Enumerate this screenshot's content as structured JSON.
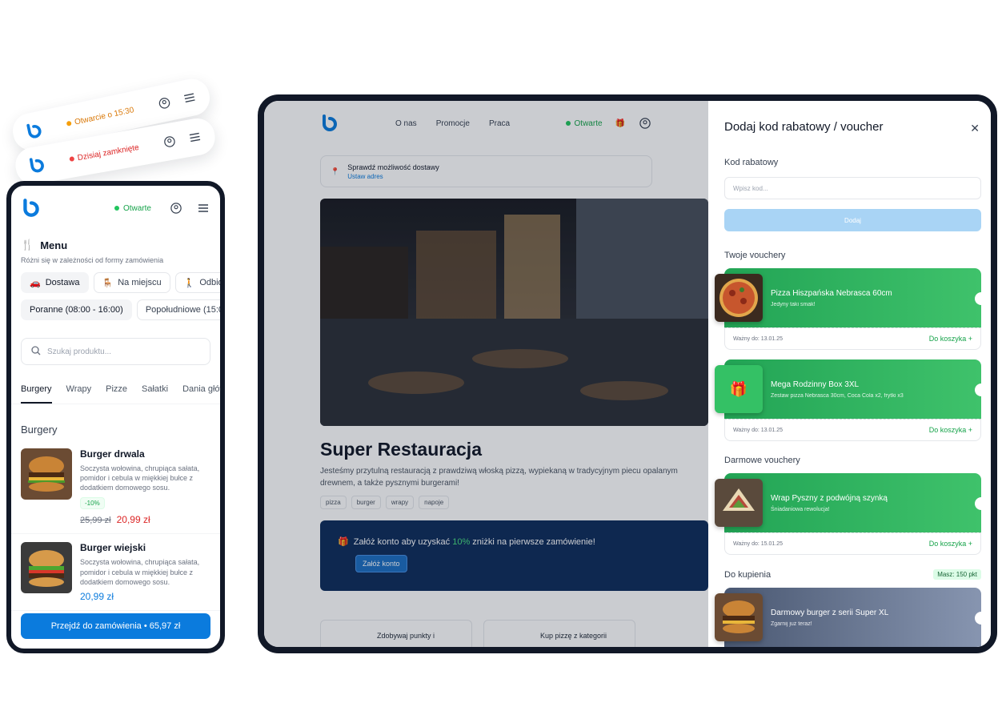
{
  "pills": [
    {
      "status": "Otwarcie o 15:30",
      "color": "#f59e0b"
    },
    {
      "status": "Dzisiaj zamknięte",
      "color": "#ef4444"
    }
  ],
  "phone": {
    "status": "Otwarte",
    "menu_title": "Menu",
    "menu_sub": "Różni się w zależności od formy zamówienia",
    "order_types": [
      "Dostawa",
      "Na miejscu",
      "Odbiór"
    ],
    "times": [
      "Poranne (08:00 - 16:00)",
      "Popołudniowe (15:0"
    ],
    "search_placeholder": "Szukaj produktu...",
    "tabs": [
      "Burgery",
      "Wrapy",
      "Pizze",
      "Sałatki",
      "Dania głów"
    ],
    "section": "Burgery",
    "products": [
      {
        "name": "Burger drwala",
        "desc": "Soczysta wołowina, chrupiąca sałata, pomidor i cebula w miękkiej bułce z dodatkiem domowego sosu.",
        "badge": "-10%",
        "old": "25,99 zł",
        "price": "20,99 zł"
      },
      {
        "name": "Burger wiejski",
        "desc": "Soczysta wołowina, chrupiąca sałata, pomidor i cebula w miękkiej bułce z dodatkiem domowego sosu.",
        "price": "20,99 zł"
      }
    ],
    "order_button": "Przejdź do zamówienia • 65,97 zł"
  },
  "site": {
    "nav": [
      "O nas",
      "Promocje",
      "Praca"
    ],
    "status": "Otwarte",
    "address_title": "Sprawdź możliwość dostawy",
    "address_link": "Ustaw adres",
    "title": "Super Restauracja",
    "description": "Jesteśmy przytulną restauracją z prawdziwą włoską pizzą, wypiekaną w tradycyjnym piecu opalanym drewnem, a także pysznymi burgerami!",
    "tags": [
      "pizza",
      "burger",
      "wrapy",
      "napoje"
    ],
    "promo_pre": "Załóż konto aby uzyskać ",
    "promo_pct": "10%",
    "promo_post": " zniżki na pierwsze zamówienie!",
    "promo_button": "Załóż konto",
    "cards": [
      "Zdobywaj punkty i",
      "Kup pizzę z kategorii"
    ]
  },
  "panel": {
    "title": "Dodaj kod rabatowy / voucher",
    "code_label": "Kod rabatowy",
    "code_placeholder": "Wpisz kod...",
    "add_button": "Dodaj",
    "my_vouchers": "Twoje vouchery",
    "free_vouchers": "Darmowe vouchery",
    "to_buy": "Do kupienia",
    "points": "Masz: 150 pkt",
    "cart_label": "Do koszyka",
    "vouchers": [
      {
        "title": "Pizza Hiszpańska Nebrasca 60cm",
        "sub": "Jedyny taki smak!",
        "valid": "Ważny do: 13.01.25"
      },
      {
        "title": "Mega Rodzinny Box 3XL",
        "sub": "Zestaw pizza Nebrasca 30cm, Coca Cola x2, frytki x3",
        "valid": "Ważny do: 13.01.25"
      },
      {
        "title": "Wrap Pyszny z podwójną szynką",
        "sub": "Śniadaniowa rewolucja!",
        "valid": "Ważny do: 15.01.25"
      },
      {
        "title": "Darmowy burger z serii Super XL",
        "sub": "Zgarnij już teraz!"
      }
    ]
  },
  "colors": {
    "brand": "#0b7bdd",
    "green": "#22a455",
    "open": "#22c55e",
    "price": "#dc2626"
  }
}
